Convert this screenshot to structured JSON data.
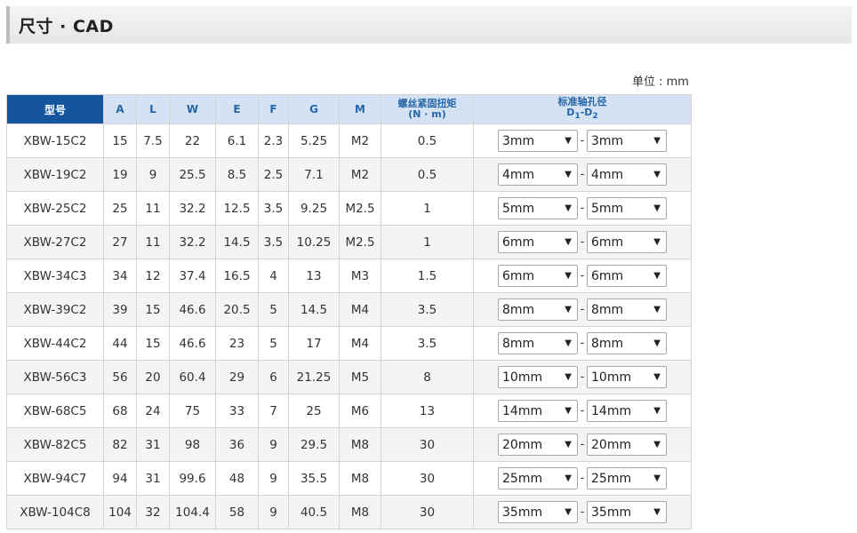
{
  "section": {
    "title": "尺寸 · CAD"
  },
  "unit": "单位 : mm",
  "table": {
    "headers": {
      "model": "型号",
      "A": "A",
      "L": "L",
      "W": "W",
      "E": "E",
      "F": "F",
      "G": "G",
      "M": "M",
      "torque_line1": "螺丝紧固扭矩",
      "torque_line2": "(N · m)",
      "bore_line1": "标准轴孔径",
      "bore_d": "D",
      "bore_sub1": "1",
      "bore_dash": "-",
      "bore_sub2": "2"
    },
    "dash": "-",
    "rows": [
      {
        "model": "XBW-15C2",
        "A": "15",
        "L": "7.5",
        "W": "22",
        "E": "6.1",
        "F": "2.3",
        "G": "5.25",
        "M": "M2",
        "torque": "0.5",
        "d1": "3mm",
        "d2": "3mm"
      },
      {
        "model": "XBW-19C2",
        "A": "19",
        "L": "9",
        "W": "25.5",
        "E": "8.5",
        "F": "2.5",
        "G": "7.1",
        "M": "M2",
        "torque": "0.5",
        "d1": "4mm",
        "d2": "4mm"
      },
      {
        "model": "XBW-25C2",
        "A": "25",
        "L": "11",
        "W": "32.2",
        "E": "12.5",
        "F": "3.5",
        "G": "9.25",
        "M": "M2.5",
        "torque": "1",
        "d1": "5mm",
        "d2": "5mm"
      },
      {
        "model": "XBW-27C2",
        "A": "27",
        "L": "11",
        "W": "32.2",
        "E": "14.5",
        "F": "3.5",
        "G": "10.25",
        "M": "M2.5",
        "torque": "1",
        "d1": "6mm",
        "d2": "6mm"
      },
      {
        "model": "XBW-34C3",
        "A": "34",
        "L": "12",
        "W": "37.4",
        "E": "16.5",
        "F": "4",
        "G": "13",
        "M": "M3",
        "torque": "1.5",
        "d1": "6mm",
        "d2": "6mm"
      },
      {
        "model": "XBW-39C2",
        "A": "39",
        "L": "15",
        "W": "46.6",
        "E": "20.5",
        "F": "5",
        "G": "14.5",
        "M": "M4",
        "torque": "3.5",
        "d1": "8mm",
        "d2": "8mm"
      },
      {
        "model": "XBW-44C2",
        "A": "44",
        "L": "15",
        "W": "46.6",
        "E": "23",
        "F": "5",
        "G": "17",
        "M": "M4",
        "torque": "3.5",
        "d1": "8mm",
        "d2": "8mm"
      },
      {
        "model": "XBW-56C3",
        "A": "56",
        "L": "20",
        "W": "60.4",
        "E": "29",
        "F": "6",
        "G": "21.25",
        "M": "M5",
        "torque": "8",
        "d1": "10mm",
        "d2": "10mm"
      },
      {
        "model": "XBW-68C5",
        "A": "68",
        "L": "24",
        "W": "75",
        "E": "33",
        "F": "7",
        "G": "25",
        "M": "M6",
        "torque": "13",
        "d1": "14mm",
        "d2": "14mm"
      },
      {
        "model": "XBW-82C5",
        "A": "82",
        "L": "31",
        "W": "98",
        "E": "36",
        "F": "9",
        "G": "29.5",
        "M": "M8",
        "torque": "30",
        "d1": "20mm",
        "d2": "20mm"
      },
      {
        "model": "XBW-94C7",
        "A": "94",
        "L": "31",
        "W": "99.6",
        "E": "48",
        "F": "9",
        "G": "35.5",
        "M": "M8",
        "torque": "30",
        "d1": "25mm",
        "d2": "25mm"
      },
      {
        "model": "XBW-104C8",
        "A": "104",
        "L": "32",
        "W": "104.4",
        "E": "58",
        "F": "9",
        "G": "40.5",
        "M": "M8",
        "torque": "30",
        "d1": "35mm",
        "d2": "35mm"
      }
    ]
  },
  "icons": {
    "dropdown": "chevron-down-icon"
  },
  "colors": {
    "header_dark": "#14559e",
    "header_light": "#d4e2f3",
    "header_text": "#2566a8",
    "row_alt": "#f4f4f4"
  }
}
